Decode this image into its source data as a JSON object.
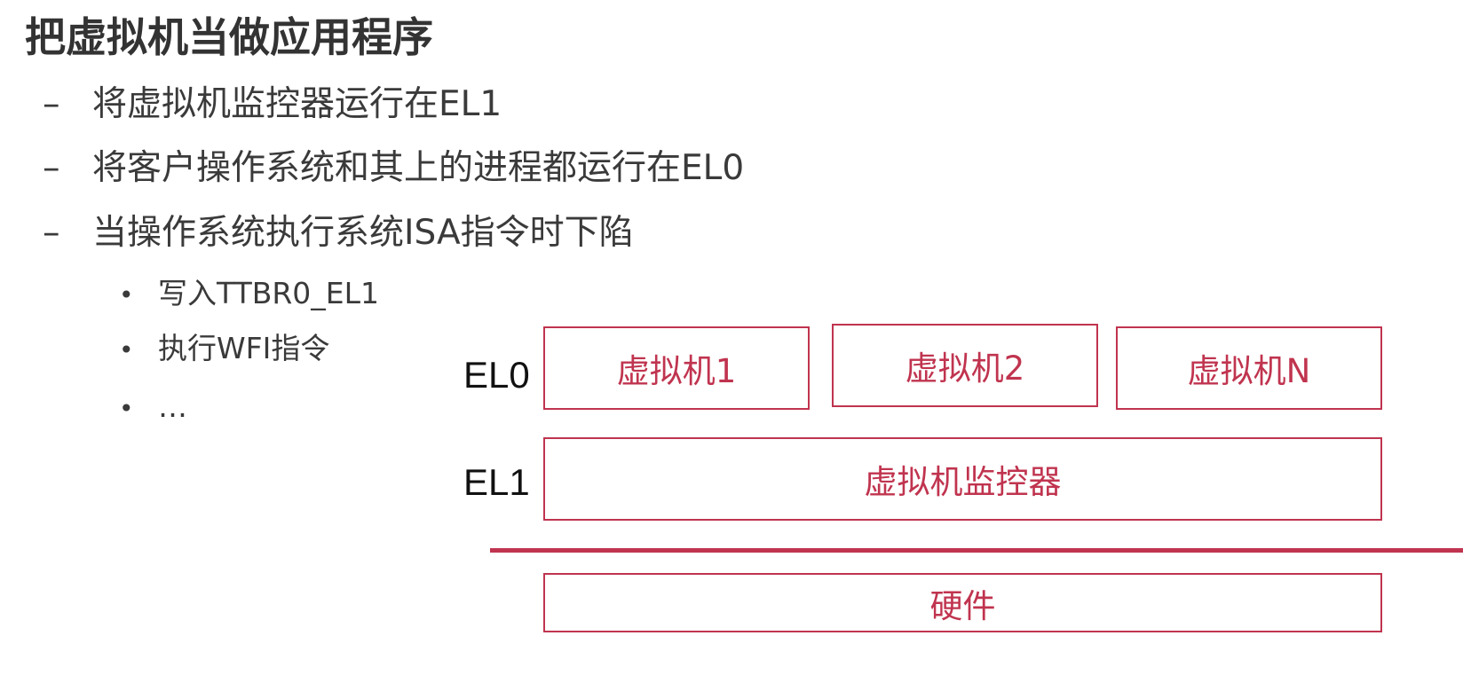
{
  "title": "把虚拟机当做应用程序",
  "bullets": [
    {
      "marker": "–",
      "text": "将虚拟机监控器运行在EL1"
    },
    {
      "marker": "–",
      "text": "将客户操作系统和其上的进程都运行在EL0"
    },
    {
      "marker": "–",
      "text": "当操作系统执行系统ISA指令时下陷"
    }
  ],
  "sub_bullets": [
    {
      "marker": "•",
      "text": "写入TTBR0_EL1"
    },
    {
      "marker": "•",
      "text": "执行WFI指令"
    },
    {
      "marker": "•",
      "text": "…"
    }
  ],
  "diagram": {
    "levels": {
      "el0": "EL0",
      "el1": "EL1"
    },
    "vms": [
      "虚拟机1",
      "虚拟机2",
      "虚拟机N"
    ],
    "hypervisor": "虚拟机监控器",
    "hardware": "硬件",
    "accent_color": "#c0344f"
  }
}
